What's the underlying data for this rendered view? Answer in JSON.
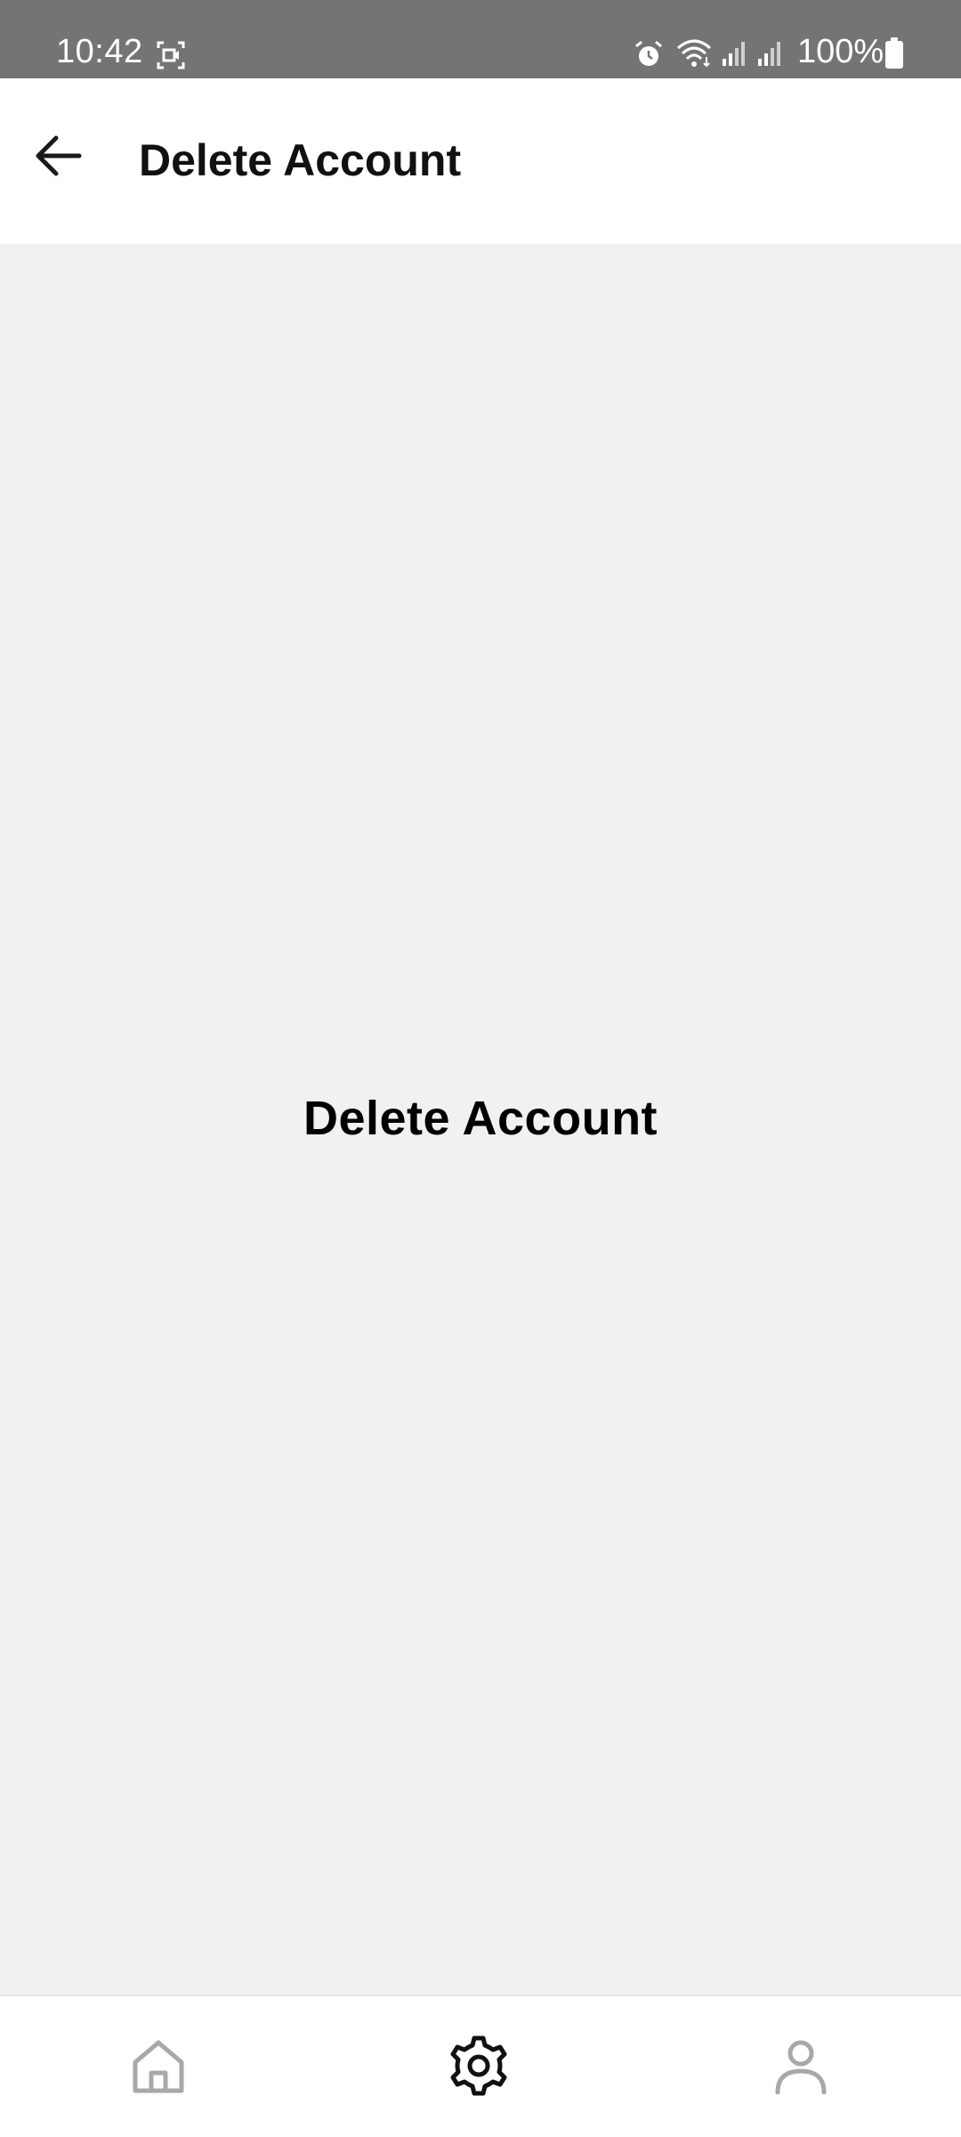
{
  "status_bar": {
    "time": "10:42",
    "battery": "100%"
  },
  "app_bar": {
    "title": "Delete Account",
    "back_icon": "arrow-left-icon"
  },
  "content": {
    "heading": "Delete Account"
  },
  "bottom_nav": {
    "items": [
      {
        "icon": "home-icon",
        "selected": false
      },
      {
        "icon": "gear-icon",
        "selected": true
      },
      {
        "icon": "user-icon",
        "selected": false
      }
    ]
  },
  "colors": {
    "status_bar": "#747474",
    "background": "#f1f1f1",
    "surface": "#ffffff",
    "nav_inactive": "#a8a8a8",
    "nav_active": "#111111"
  }
}
